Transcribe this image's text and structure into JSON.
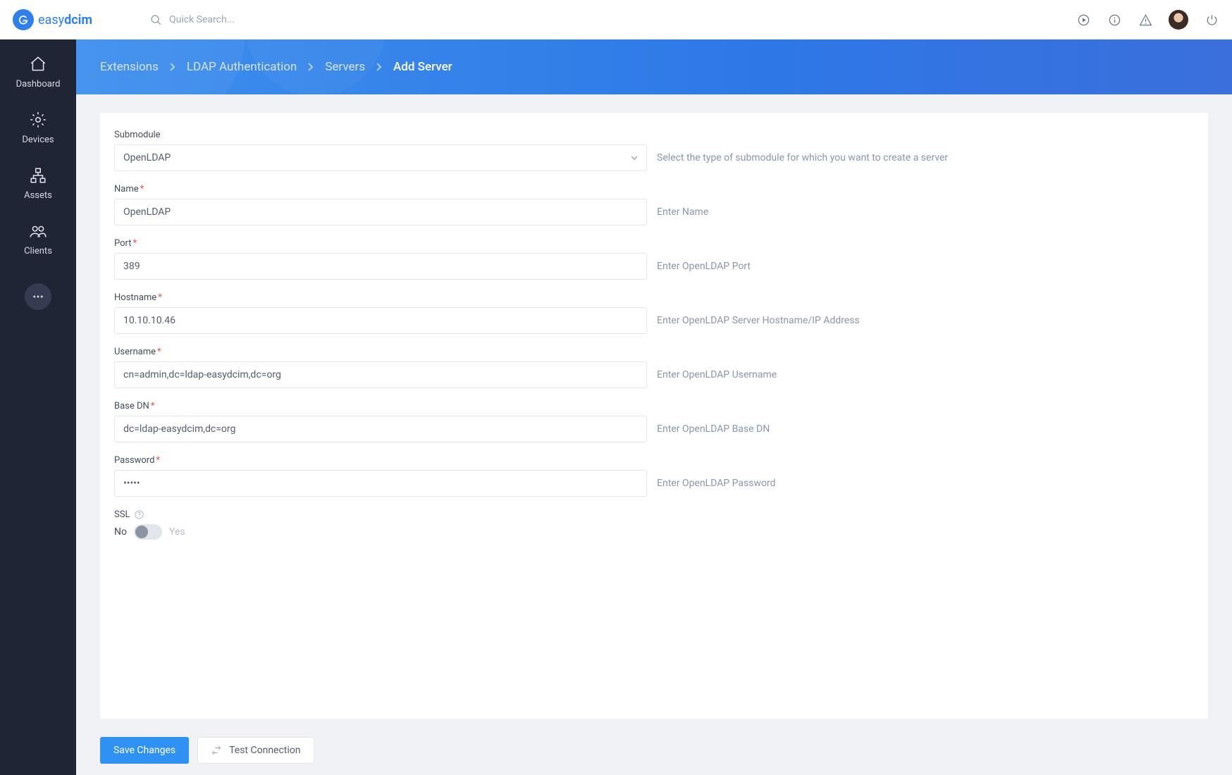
{
  "header": {
    "brand_a": "easy",
    "brand_b": "dcim",
    "search_placeholder": "Quick Search..."
  },
  "sidebar": {
    "items": [
      {
        "label": "Dashboard"
      },
      {
        "label": "Devices"
      },
      {
        "label": "Assets"
      },
      {
        "label": "Clients"
      }
    ]
  },
  "breadcrumb": {
    "parts": [
      "Extensions",
      "LDAP Authentication",
      "Servers"
    ],
    "current": "Add Server"
  },
  "form": {
    "submodule": {
      "label": "Submodule",
      "value": "OpenLDAP",
      "hint": "Select the type of submodule for which you want to create a server"
    },
    "name": {
      "label": "Name",
      "value": "OpenLDAP",
      "hint": "Enter Name"
    },
    "port": {
      "label": "Port",
      "value": "389",
      "hint": "Enter OpenLDAP Port"
    },
    "hostname": {
      "label": "Hostname",
      "value": "10.10.10.46",
      "hint": "Enter OpenLDAP Server Hostname/IP Address"
    },
    "username": {
      "label": "Username",
      "value": "cn=admin,dc=ldap-easydcim,dc=org",
      "hint": "Enter OpenLDAP Username"
    },
    "basedn": {
      "label": "Base DN",
      "value": "dc=ldap-easydcim,dc=org",
      "hint": "Enter OpenLDAP Base DN"
    },
    "password": {
      "label": "Password",
      "value": "•••••",
      "hint": "Enter OpenLDAP Password"
    },
    "ssl": {
      "label": "SSL",
      "no": "No",
      "yes": "Yes",
      "on": false
    }
  },
  "actions": {
    "save": "Save Changes",
    "test": "Test Connection"
  }
}
